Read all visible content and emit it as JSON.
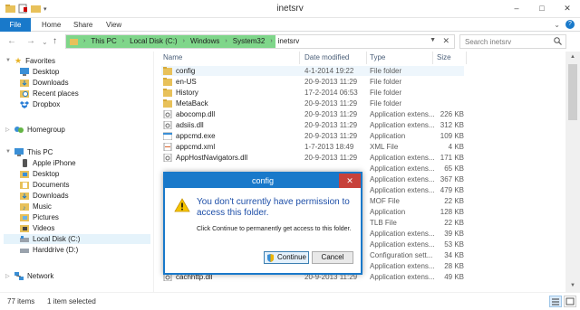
{
  "window": {
    "title": "inetsrv",
    "minimize": "–",
    "maximize": "□",
    "close": "✕"
  },
  "ribbon": {
    "tabs": [
      "File",
      "Home",
      "Share",
      "View"
    ],
    "expand": "⌄",
    "help": "?"
  },
  "nav": {
    "back": "←",
    "forward": "→",
    "recent": "⌄",
    "up": "↑",
    "breadcrumbs": [
      "This PC",
      "Local Disk (C:)",
      "Windows",
      "System32",
      "inetsrv"
    ],
    "address_progress": 0.54,
    "search_placeholder": "Search inetsrv"
  },
  "sidebar": {
    "favorites": {
      "label": "Favorites",
      "items": [
        "Desktop",
        "Downloads",
        "Recent places",
        "Dropbox"
      ]
    },
    "homegroup": "Homegroup",
    "thispc": {
      "label": "This PC",
      "items": [
        "Apple iPhone",
        "Desktop",
        "Documents",
        "Downloads",
        "Music",
        "Pictures",
        "Videos",
        "Local Disk (C:)",
        "Harddrive (D:)"
      ]
    },
    "network": "Network"
  },
  "columns": {
    "name": "Name",
    "date": "Date modified",
    "type": "Type",
    "size": "Size"
  },
  "files": [
    {
      "name": "config",
      "date": "4-1-2014 19:22",
      "type": "File folder",
      "size": "",
      "icon": "folder"
    },
    {
      "name": "en-US",
      "date": "20-9-2013 11:29",
      "type": "File folder",
      "size": "",
      "icon": "folder"
    },
    {
      "name": "History",
      "date": "17-2-2014 06:53",
      "type": "File folder",
      "size": "",
      "icon": "folder"
    },
    {
      "name": "MetaBack",
      "date": "20-9-2013 11:29",
      "type": "File folder",
      "size": "",
      "icon": "folder"
    },
    {
      "name": "abocomp.dll",
      "date": "20-9-2013 11:29",
      "type": "Application extens...",
      "size": "226 KB",
      "icon": "dll"
    },
    {
      "name": "adsiis.dll",
      "date": "20-9-2013 11:29",
      "type": "Application extens...",
      "size": "312 KB",
      "icon": "dll"
    },
    {
      "name": "appcmd.exe",
      "date": "20-9-2013 11:29",
      "type": "Application",
      "size": "109 KB",
      "icon": "exe"
    },
    {
      "name": "appcmd.xml",
      "date": "1-7-2013 18:49",
      "type": "XML File",
      "size": "4 KB",
      "icon": "xml"
    },
    {
      "name": "AppHostNavigators.dll",
      "date": "20-9-2013 11:29",
      "type": "Application extens...",
      "size": "171 KB",
      "icon": "dll"
    },
    {
      "name": "",
      "date": "",
      "type": "Application extens...",
      "size": "65 KB",
      "icon": ""
    },
    {
      "name": "",
      "date": "",
      "type": "Application extens...",
      "size": "367 KB",
      "icon": ""
    },
    {
      "name": "",
      "date": "",
      "type": "Application extens...",
      "size": "479 KB",
      "icon": ""
    },
    {
      "name": "",
      "date": "",
      "type": "MOF File",
      "size": "22 KB",
      "icon": ""
    },
    {
      "name": "",
      "date": "",
      "type": "Application",
      "size": "128 KB",
      "icon": ""
    },
    {
      "name": "",
      "date": "",
      "type": "TLB File",
      "size": "22 KB",
      "icon": ""
    },
    {
      "name": "",
      "date": "",
      "type": "Application extens...",
      "size": "39 KB",
      "icon": ""
    },
    {
      "name": "",
      "date": "",
      "type": "Application extens...",
      "size": "53 KB",
      "icon": ""
    },
    {
      "name": "",
      "date": "",
      "type": "Configuration sett...",
      "size": "34 KB",
      "icon": ""
    },
    {
      "name": "cachfile.dll",
      "date": "20-9-2013 11:29",
      "type": "Application extens...",
      "size": "28 KB",
      "icon": "dll"
    },
    {
      "name": "cachhttp.dll",
      "date": "20-9-2013 11:29",
      "type": "Application extens...",
      "size": "49 KB",
      "icon": "dll"
    }
  ],
  "status": {
    "items": "77 items",
    "selected": "1 item selected"
  },
  "dialog": {
    "title": "config",
    "close": "✕",
    "heading": "You don't currently have permission to access this folder.",
    "message": "Click Continue to permanently get access to this folder.",
    "continue": "Continue",
    "cancel": "Cancel"
  },
  "colors": {
    "accent": "#1979ca",
    "progress": "#7fd68a",
    "folder": "#e8c15a"
  }
}
